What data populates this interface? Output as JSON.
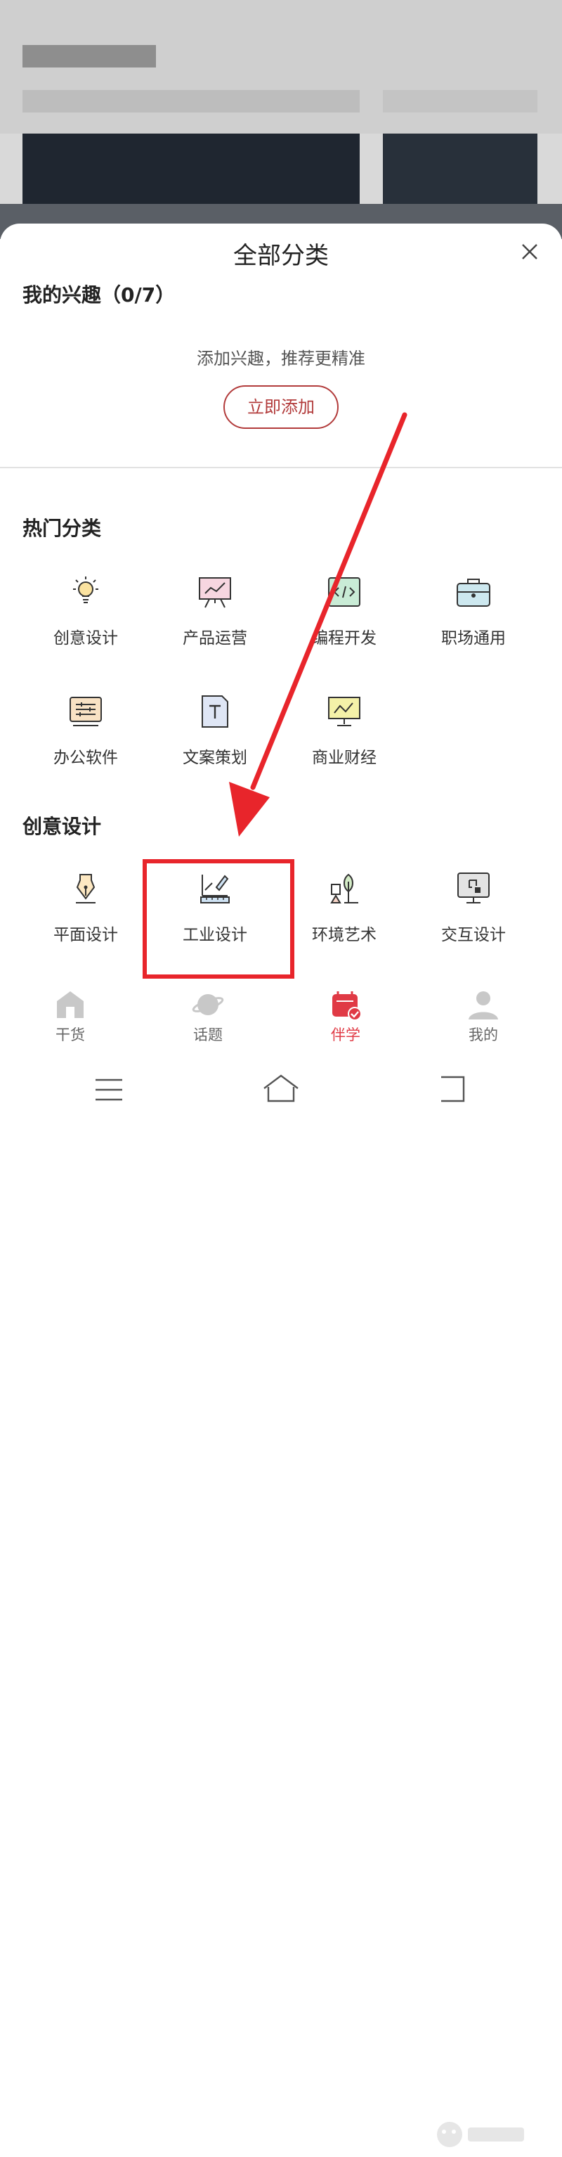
{
  "sheet": {
    "title": "全部分类",
    "interests": {
      "title": "我的兴趣（0/7）",
      "hint": "添加兴趣，推荐更精准",
      "add_button": "立即添加"
    },
    "hot": {
      "title": "热门分类",
      "items": [
        {
          "label": "创意设计",
          "icon": "lightbulb-icon"
        },
        {
          "label": "产品运营",
          "icon": "presentation-chart-icon"
        },
        {
          "label": "编程开发",
          "icon": "code-icon"
        },
        {
          "label": "职场通用",
          "icon": "briefcase-icon"
        },
        {
          "label": "办公软件",
          "icon": "settings-sliders-icon"
        },
        {
          "label": "文案策划",
          "icon": "text-document-icon"
        },
        {
          "label": "商业财经",
          "icon": "finance-board-icon"
        }
      ]
    },
    "creative": {
      "title": "创意设计",
      "items": [
        {
          "label": "平面设计",
          "icon": "pen-nib-icon"
        },
        {
          "label": "工业设计",
          "icon": "ruler-pencil-icon"
        },
        {
          "label": "环境艺术",
          "icon": "tree-icon"
        },
        {
          "label": "交互设计",
          "icon": "monitor-icon"
        }
      ]
    }
  },
  "tabbar": {
    "items": [
      {
        "label": "干货",
        "icon": "home-icon"
      },
      {
        "label": "话题",
        "icon": "planet-icon"
      },
      {
        "label": "伴学",
        "icon": "calendar-check-icon"
      },
      {
        "label": "我的",
        "icon": "user-icon"
      }
    ]
  },
  "colors": {
    "accent": "#e03a45",
    "button": "#b23b3b",
    "annotation": "#e8252b"
  }
}
